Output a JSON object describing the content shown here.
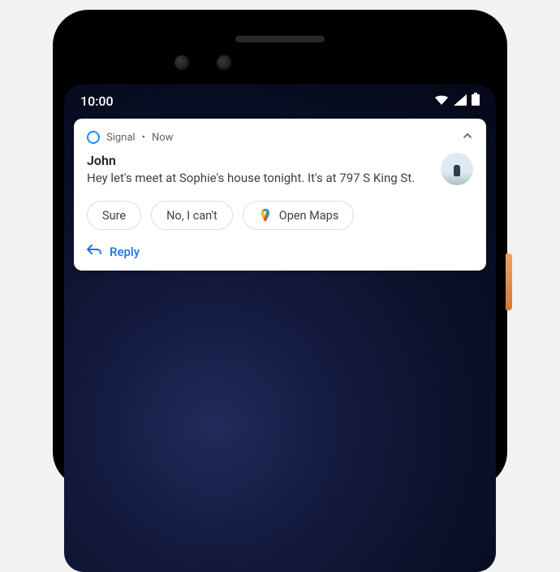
{
  "statusbar": {
    "time": "10:00"
  },
  "notification": {
    "app_name": "Signal",
    "time_label": "Now",
    "sender": "John",
    "message": "Hey let's meet at Sophie's house tonight. It's at 797 S King St.",
    "suggestions": {
      "sure": "Sure",
      "no": "No, I can't",
      "open_maps": "Open Maps"
    },
    "reply_label": "Reply"
  }
}
